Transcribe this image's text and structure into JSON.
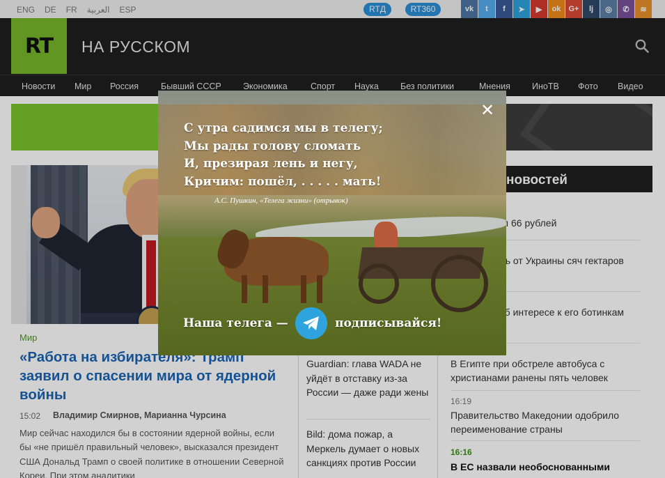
{
  "languages": [
    "ENG",
    "DE",
    "FR",
    "العربية",
    "ESP"
  ],
  "channels": {
    "rtd": "RTД",
    "rt360": "RT360"
  },
  "social_icons": [
    "vk-icon",
    "twitter-icon",
    "facebook-icon",
    "telegram-icon",
    "youtube-icon",
    "odnoklassniki-icon",
    "googleplus-icon",
    "livejournal-icon",
    "instagram-icon",
    "viber-icon",
    "rss-icon"
  ],
  "social_labels": [
    "vk",
    "t",
    "f",
    "➤",
    "▶",
    "ok",
    "G+",
    "lj",
    "◎",
    "✆",
    "≋"
  ],
  "logo": {
    "text": "RT"
  },
  "header": {
    "title": "НА РУССКОМ"
  },
  "nav": [
    "Новости",
    "Мир",
    "Россия",
    "Бывший СССР",
    "Экономика",
    "Спорт",
    "Наука",
    "Без политики",
    "Мнения",
    "ИноТВ",
    "Фото",
    "Видео"
  ],
  "main_article": {
    "rubric": "Мир",
    "headline": "«Работа на избирателя»: Трамп заявил о спасении мира от ядерной войны",
    "time": "15:02",
    "authors": "Владимир Смирнов, Марианна Чурсина",
    "lead": "Мир сейчас находился бы в состоянии ядерной войны, если бы «не пришёл правильный человек», высказался президент США Дональд Трамп о своей политике в отношении Северной Кореи. При этом аналитики"
  },
  "middle_column": [
    "Guardian: глава WADA не уйдёт в отставку из-за России — даже ради жены",
    "Bild: дома пожар, а Меркель думает о новых санкциях против России"
  ],
  "news_feed": {
    "title": "новостей",
    "items": [
      {
        "time": "",
        "text": "ра превысил 66 рублей"
      },
      {
        "time": "",
        "text": "жет получить от Украины сяч гектаров земли"
      },
      {
        "time": "",
        "text": "рассказал об интересе к его ботинкам"
      },
      {
        "time": "",
        "text": "В Египте при обстреле автобуса с христианами ранены пять человек"
      },
      {
        "time": "16:19",
        "text": "Правительство Македонии одобрило переименование страны"
      },
      {
        "time": "16:16",
        "text": "В ЕС назвали необоснованными"
      }
    ]
  },
  "popup": {
    "poem": [
      "С утра садимся мы в телегу;",
      "Мы рады голову сломать",
      "И, презирая лень и негу,",
      "Кричим: пошёл, . . . . . мать!"
    ],
    "attribution": "А.С. Пушкин, «Телега жизни» (отрывок)",
    "cta_left": "Наша телега —",
    "cta_right": "подписывайся!",
    "close": "✕"
  },
  "colors": {
    "accent_green": "#77b82a",
    "link_blue": "#1a64b4",
    "header_dark": "#1f1f1f",
    "telegram_blue": "#2ea3dd"
  }
}
